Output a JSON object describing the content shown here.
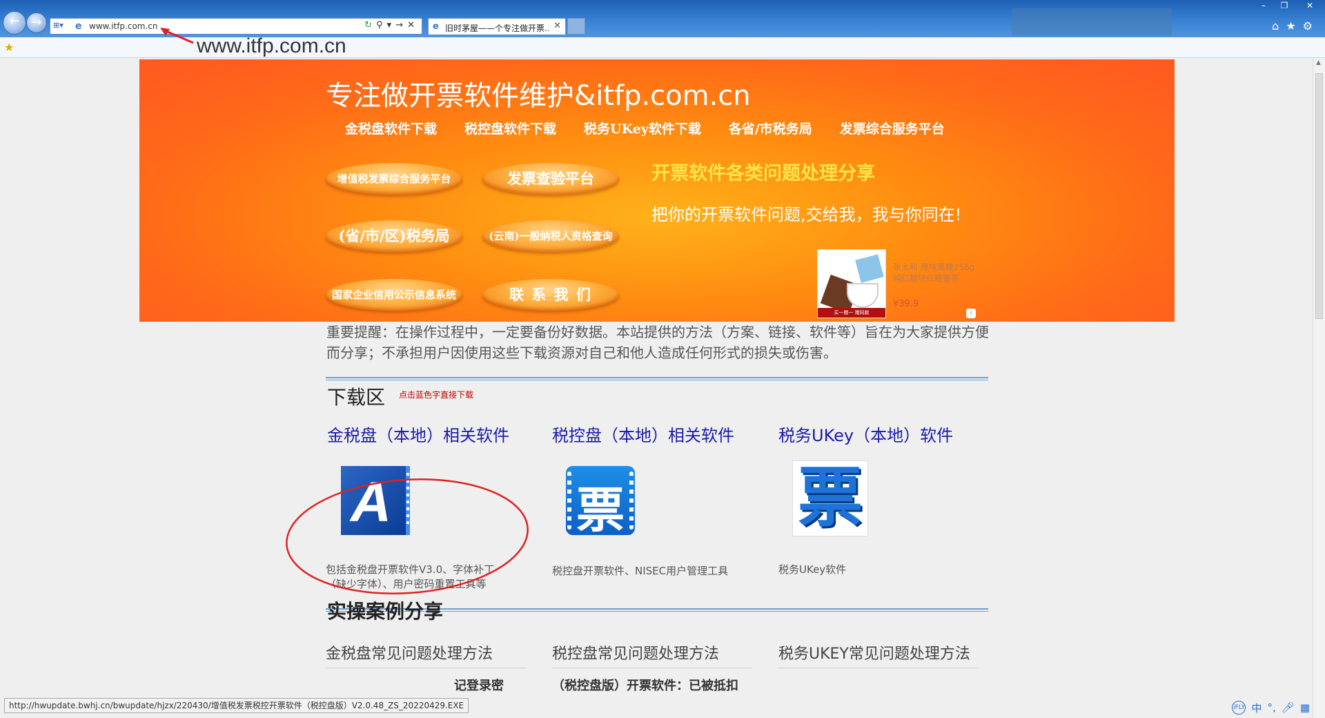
{
  "browser": {
    "url": "www.itfp.com.cn",
    "tab_title": "旧时茅屋——个专注做开票...",
    "status_url": "http://hwupdate.bwhj.cn/bwupdate/hjzx/220430/增值税发票税控开票软件（税控盘版）V2.0.48_ZS_20220429.EXE"
  },
  "annotation": {
    "url_label": "www.itfp.com.cn"
  },
  "banner": {
    "title": "专注做开票软件维护&itfp.com.cn",
    "nav": [
      "金税盘软件下载",
      "税控盘软件下载",
      "税务UKey软件下载",
      "各省/市税务局",
      "发票综合服务平台"
    ],
    "pills": [
      "增值税发票综合服务平台",
      "发票查验平台",
      "(省/市/区)税务局",
      "(云南)一般纳税人资格查询",
      "国家企业信用公示信息系统",
      "联 系 我 们"
    ],
    "share_title": "开票软件各类问题处理分享",
    "share_slogan": "把你的开票软件问题,交给我，我与你同在!",
    "ad": {
      "desc": "张太和 原味黑糖256g 纯红糖块红糖姜茶",
      "price": "¥39.9",
      "img_text": "买一赠一 赠同款"
    }
  },
  "notice": "重要提醒：在操作过程中，一定要备份好数据。本站提供的方法（方案、链接、软件等）旨在为大家提供方便而分享；不承担用户因使用这些下载资源对自己和他人造成任何形式的损失或伤害。",
  "download": {
    "title": "下载区",
    "hint": "点击蓝色字直接下载",
    "categories": [
      {
        "title": "金税盘（本地）相关软件",
        "desc": "包括金税盘开票软件V3.0、字体补丁（缺少字体）、用户密码重置工具等",
        "icon": "a-letter-icon"
      },
      {
        "title": "税控盘（本地）相关软件",
        "desc": "税控盘开票软件、NISEC用户管理工具",
        "icon": "piao-blue-icon"
      },
      {
        "title": "税务UKey（本地）软件",
        "desc": "税务UKey软件",
        "icon": "piao-large-icon"
      }
    ]
  },
  "cases": {
    "title": "实操案例分享",
    "columns": [
      "金税盘常见问题处理方法",
      "税控盘常见问题处理方法",
      "税务UKEY常见问题处理方法"
    ],
    "items": [
      "记登录密",
      "（税控盘版）开票软件：已被抵扣"
    ]
  },
  "ime": {
    "label": "中"
  },
  "colors": {
    "banner": "#ff7a1a",
    "link": "#1a1aaa",
    "hint": "#c00000",
    "annotation": "#e02020"
  }
}
